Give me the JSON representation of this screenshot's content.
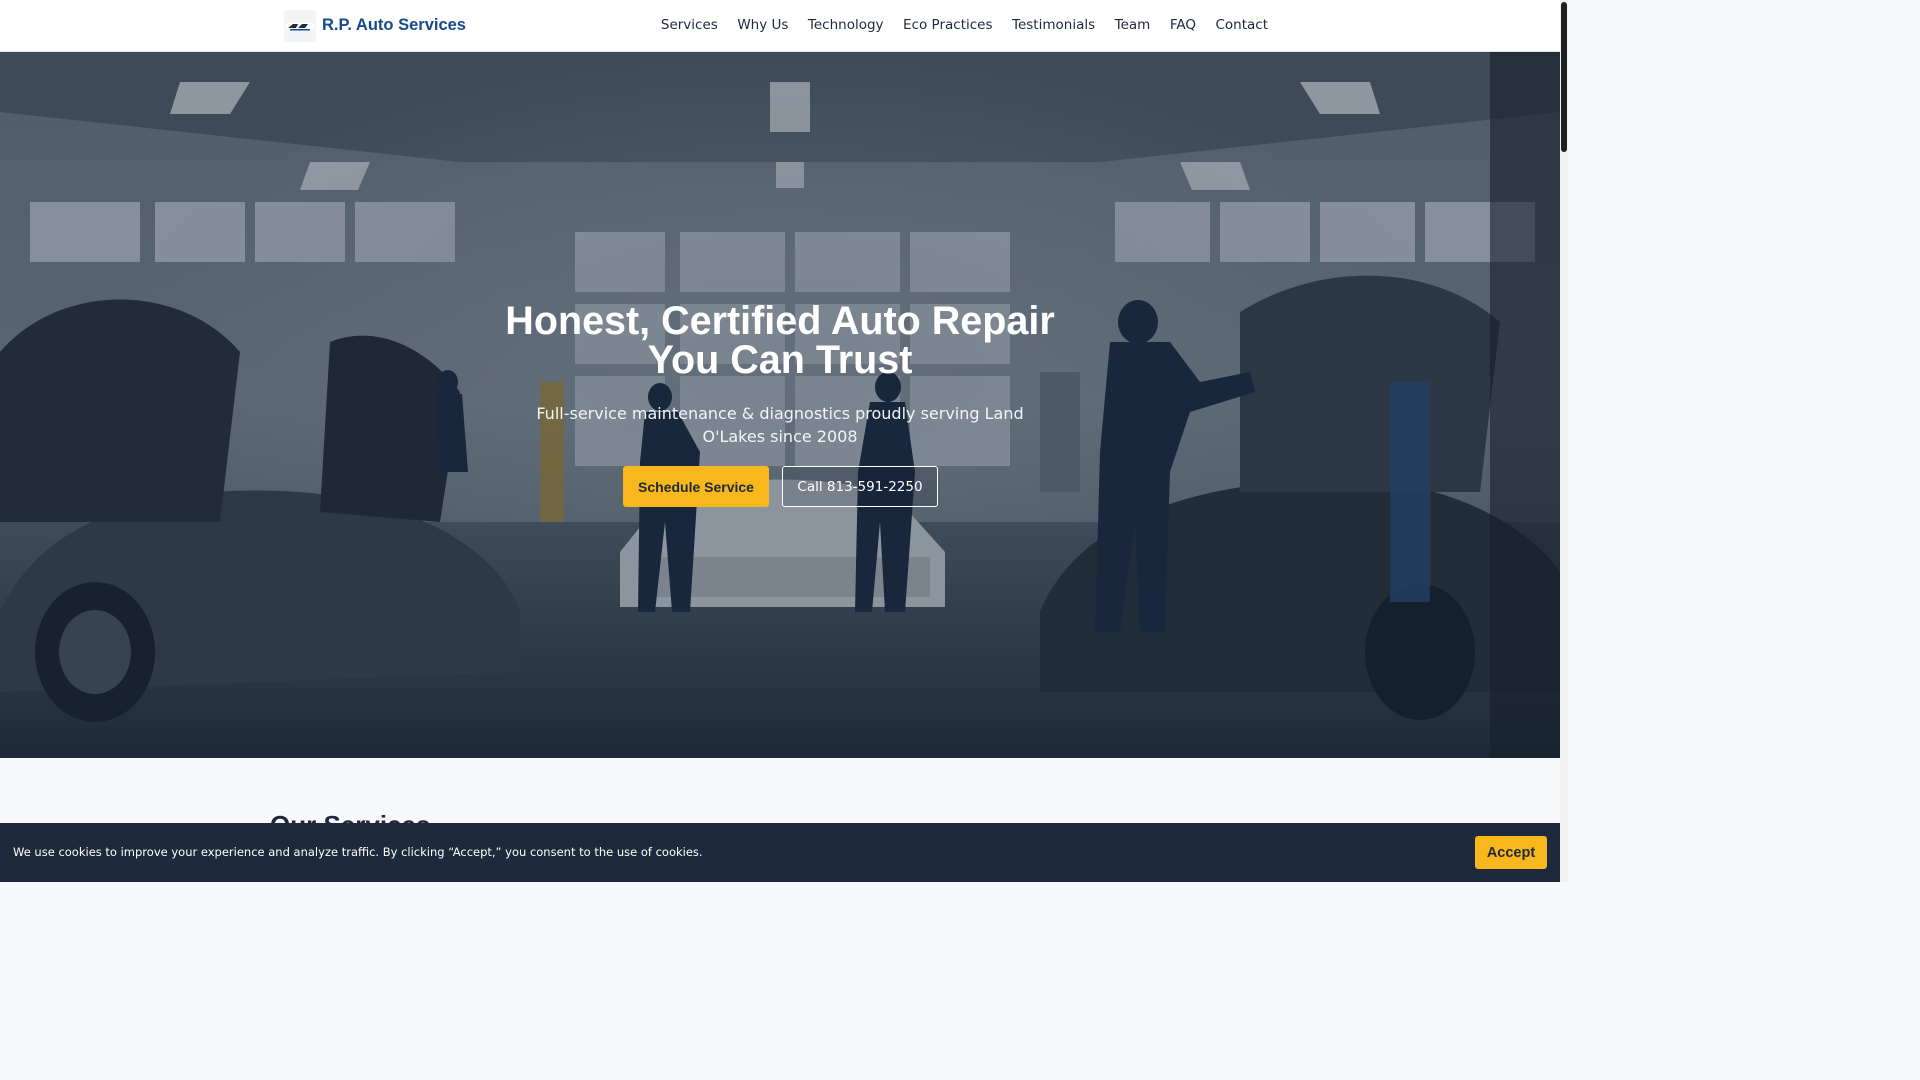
{
  "header": {
    "brand": "R.P. Auto Services",
    "logo_icon": "company-logo-icon",
    "nav": [
      "Services",
      "Why Us",
      "Technology",
      "Eco Practices",
      "Testimonials",
      "Team",
      "FAQ",
      "Contact"
    ]
  },
  "hero": {
    "title": "Honest, Certified Auto Repair You Can Trust",
    "subtitle": "Full-service maintenance & diagnostics proudly serving Land O'Lakes since 2008",
    "primary_button": "Schedule Service",
    "secondary_button": "Call 813-591-2250",
    "background": "auto-repair-garage-photo"
  },
  "services": {
    "heading": "Our Services"
  },
  "cookie": {
    "text": "We use cookies to improve your experience and analyze traffic. By clicking “Accept,” you consent to the use of cookies.",
    "accept": "Accept"
  },
  "colors": {
    "brand": "#174a8c",
    "accent": "#f8b71c",
    "banner": "#1e293b"
  }
}
